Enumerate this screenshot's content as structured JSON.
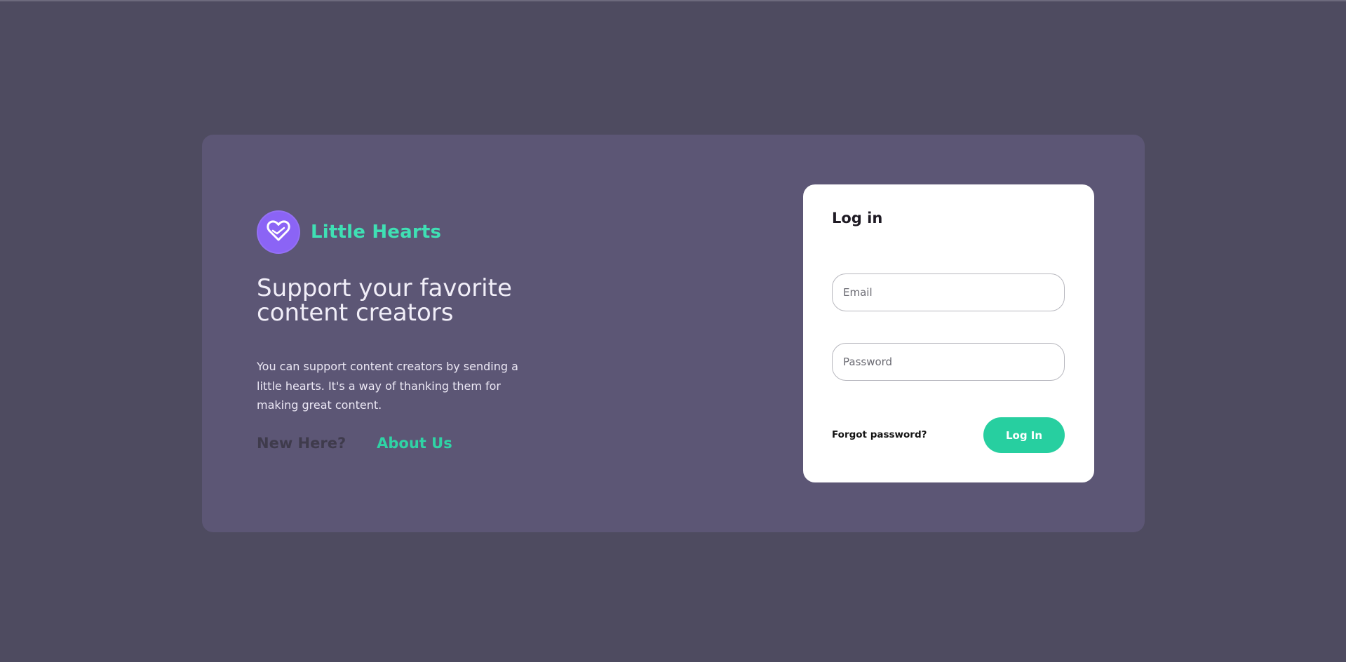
{
  "brand": {
    "name": "Little Hearts",
    "logo_icon": "heart-icon",
    "logo_color": "#8b64f5",
    "name_color": "#3fe0b4"
  },
  "hero": {
    "tagline": "Support your favorite content creators",
    "description": "You can support content creators by sending a little hearts. It's a way of thanking them for making great content."
  },
  "links": {
    "new_here": "New Here?",
    "about_us": "About Us"
  },
  "login": {
    "title": "Log in",
    "email_placeholder": "Email",
    "password_placeholder": "Password",
    "forgot_password": "Forgot password?",
    "submit_label": "Log In",
    "accent_color": "#27cfa0"
  }
}
